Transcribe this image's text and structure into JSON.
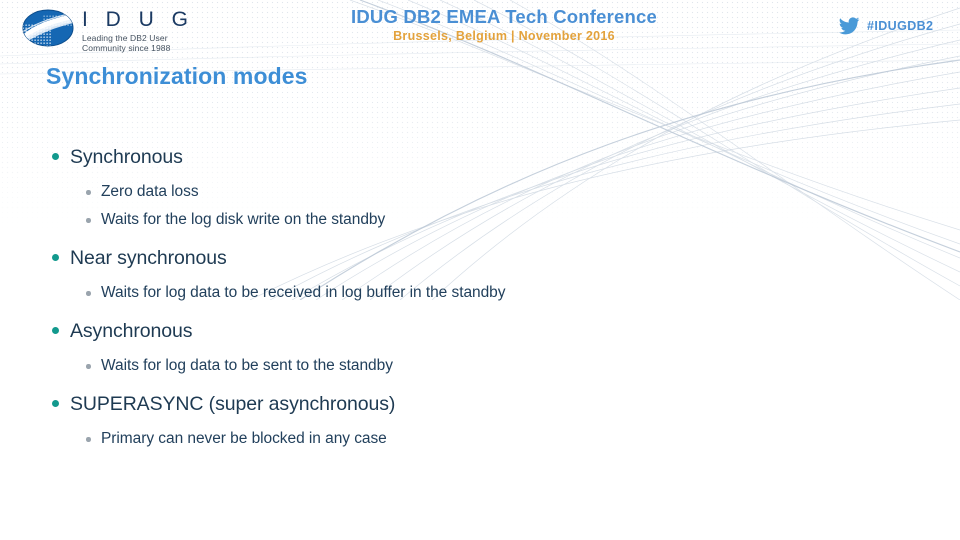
{
  "header": {
    "logo": {
      "icon": "idug-globe-logo-icon",
      "wordmark": "I D U G",
      "tagline_line1": "Leading the DB2 User",
      "tagline_line2": "Community since 1988"
    },
    "conference": {
      "title": "IDUG DB2 EMEA Tech Conference",
      "subtitle": "Brussels, Belgium  |  November 2016"
    },
    "social": {
      "icon": "twitter-bird-icon",
      "hashtag": "#IDUGDB2"
    }
  },
  "slide": {
    "title": "Synchronization modes"
  },
  "bullets": [
    {
      "label": "Synchronous",
      "children": [
        "Zero data loss",
        "Waits for the log disk write on the standby"
      ]
    },
    {
      "label": "Near synchronous",
      "children": [
        "Waits for log data to be received in log buffer in the standby"
      ]
    },
    {
      "label": "Asynchronous",
      "children": [
        "Waits for log data to be sent to the standby"
      ]
    },
    {
      "label": "SUPERASYNC (super asynchronous)",
      "children": [
        "Primary can never be blocked in any case"
      ]
    }
  ],
  "colors": {
    "title_blue": "#3d8ed6",
    "conference_blue": "#4a8fd4",
    "conference_orange": "#e3a23c",
    "bullet_teal": "#12998d",
    "sub_bullet_gray": "#9aa4ad",
    "body_navy": "#1e3a52",
    "logo_navy": "#1b3a63",
    "background": "#ffffff"
  }
}
